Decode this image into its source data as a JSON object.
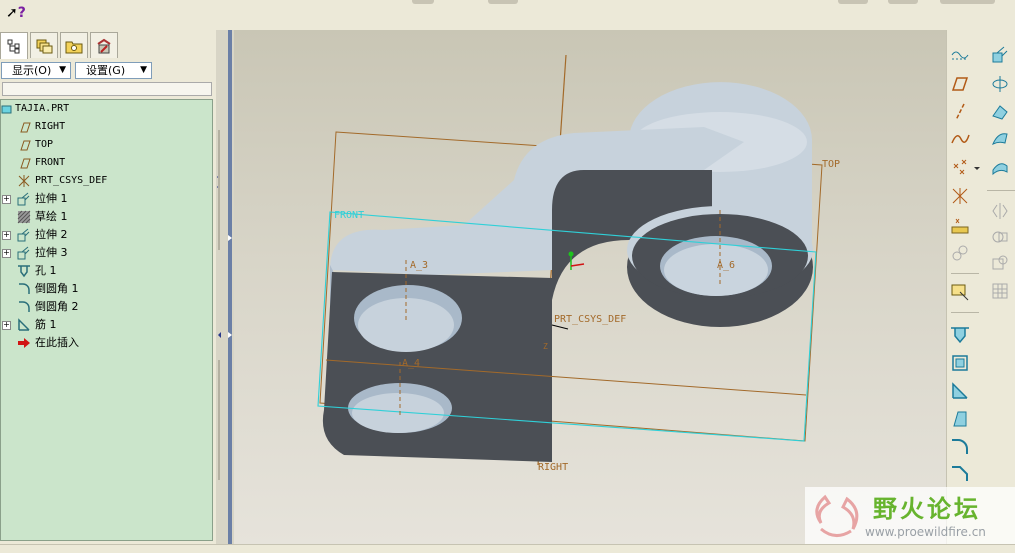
{
  "app": {
    "help_cursor": "?"
  },
  "model_tree_panel": {
    "tabs": [
      {
        "icon": "model-tree-icon"
      },
      {
        "icon": "layer-tree-icon"
      },
      {
        "icon": "folder-browser-icon"
      },
      {
        "icon": "favorites-icon"
      }
    ],
    "show_menu": "显示(O)",
    "settings_menu": "设置(G)",
    "items": [
      {
        "label": "TAJIA.PRT",
        "icon": "part-icon",
        "expandable": false
      },
      {
        "label": "RIGHT",
        "icon": "datum-plane-icon",
        "expandable": false
      },
      {
        "label": "TOP",
        "icon": "datum-plane-icon",
        "expandable": false
      },
      {
        "label": "FRONT",
        "icon": "datum-plane-icon",
        "expandable": false
      },
      {
        "label": "PRT_CSYS_DEF",
        "icon": "coordinate-system-icon",
        "expandable": false
      },
      {
        "label": "拉伸 1",
        "icon": "extrude-icon",
        "expandable": true
      },
      {
        "label": "草绘 1",
        "icon": "sketch-icon",
        "expandable": false
      },
      {
        "label": "拉伸 2",
        "icon": "extrude-icon",
        "expandable": true
      },
      {
        "label": "拉伸 3",
        "icon": "extrude-icon",
        "expandable": true
      },
      {
        "label": "孔 1",
        "icon": "hole-icon",
        "expandable": false
      },
      {
        "label": "倒圆角 1",
        "icon": "round-icon",
        "expandable": false
      },
      {
        "label": "倒圆角 2",
        "icon": "round-icon",
        "expandable": false
      },
      {
        "label": "筋 1",
        "icon": "rib-icon",
        "expandable": true
      },
      {
        "label": "在此插入",
        "icon": "insert-here-arrow-icon",
        "expandable": false
      }
    ]
  },
  "viewport": {
    "labels": {
      "top": "TOP",
      "front": "FRONT",
      "right": "RIGHT",
      "csys": "PRT_CSYS_DEF",
      "axis_a3": "A_3",
      "axis_a4": "A_4",
      "axis_a6": "A_6",
      "csys_z": "Z"
    },
    "colors": {
      "datum_plane": "#a36a2a",
      "front_plane": "#2fd0d8",
      "part_dark": "#4b4f55",
      "part_light": "#c7d2dc"
    }
  },
  "right_toolbar": {
    "left_column": [
      "datum-display-icon",
      "datum-plane-icon",
      "datum-axis-icon",
      "datum-curve-icon",
      "datum-point-icon",
      "offset-point-icon",
      "csys-icon",
      "analysis-icon",
      "annotation-icon",
      "hole-icon",
      "shell-icon",
      "rib-icon",
      "draft-icon",
      "round-icon",
      "chamfer-icon"
    ],
    "right_column": [
      "extrude-icon",
      "revolve-icon",
      "variable-sweep-icon",
      "blend-icon",
      "style-icon",
      "mirror-icon",
      "merge-icon",
      "trim-icon",
      "pattern-icon"
    ]
  },
  "watermark": {
    "title": "野火论坛",
    "url": "www.proewildfire.cn"
  }
}
